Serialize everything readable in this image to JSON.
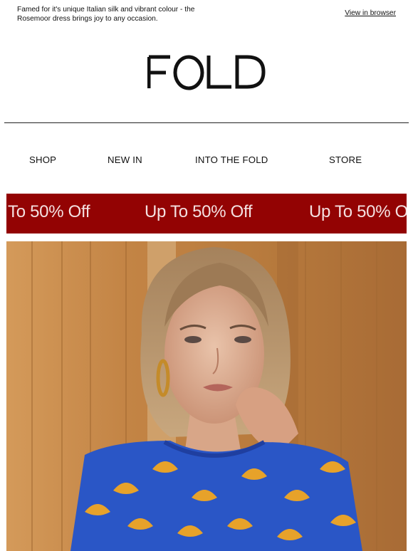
{
  "preheader": {
    "text": "Famed for it's unique Italian silk and vibrant colour - the Rosemoor dress brings joy to any occasion.",
    "view_in_browser": "View in browser"
  },
  "brand": {
    "logo_text": "FOLD"
  },
  "nav": [
    {
      "label": "SHOP"
    },
    {
      "label": "NEW IN"
    },
    {
      "label": "INTO THE FOLD"
    },
    {
      "label": "STORE"
    }
  ],
  "banner": {
    "promo_text": "Up To 50% Off",
    "promo_partial_left": "To 50% Off",
    "background_color": "#930303"
  },
  "hero": {
    "image_name": "model-in-blue-ginkgo-print-dress"
  }
}
